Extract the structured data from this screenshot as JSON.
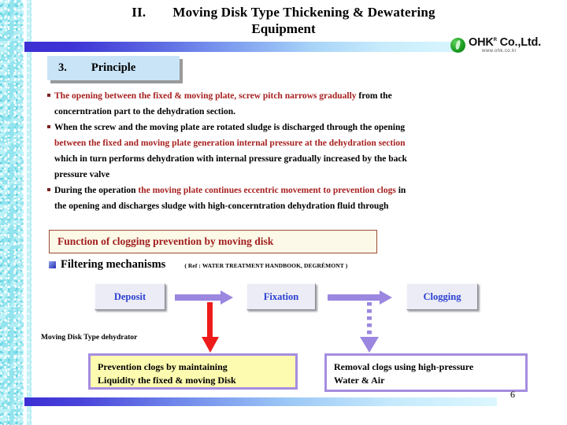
{
  "slide": {
    "page_number": "6",
    "title": {
      "number": "II.",
      "line1": "Moving Disk Type Thickening & Dewatering",
      "line2": "Equipment"
    },
    "logo": {
      "name": "OHK",
      "suffix": "Co.,Ltd.",
      "superscript": "R",
      "url": "www.ohk.co.kr"
    },
    "section": {
      "number": "3.",
      "label": "Principle"
    },
    "bullets": [
      {
        "red_text": "The opening between the fixed & moving plate, screw pitch narrows gradually",
        "black_text": " from the",
        "continuation": "concerntration part to the dehydration section."
      },
      {
        "black_text": "When the screw and the moving plate are rotated sludge is discharged through the opening",
        "red_continuation": "between the fixed and moving plate generation internal pressure at the dehydration section",
        "continuation2": "which in turn performs dehydration with internal pressure gradually increased by the back",
        "continuation3": "pressure valve"
      },
      {
        "black_text": "During the operation ",
        "red_text": "the moving plate continues eccentric movement to prevention clogs",
        "black_text2": " in",
        "continuation": "the opening and discharges sludge with high-concerntration dehydration fluid through"
      }
    ],
    "function_banner": "Function of clogging prevention by moving disk",
    "filtering": {
      "title": "Filtering mechanisms",
      "reference": "( Ref : WATER TREATMENT HANDBOOK,  DEGRÉMONT )"
    },
    "flow_boxes": [
      {
        "label": "Deposit"
      },
      {
        "label": "Fixation"
      },
      {
        "label": "Clogging"
      }
    ],
    "dehydrator_label": "Moving Disk Type dehydrator",
    "result_boxes": [
      {
        "line1": "Prevention clogs by maintaining",
        "line2": "Liquidity the fixed & moving Disk"
      },
      {
        "line1": "Removal clogs using high-pressure",
        "line2": "Water & Air"
      }
    ],
    "colors": {
      "red_accent": "#a82020",
      "blue_box_text": "#2a3fd0",
      "purple_arrow": "#9b86e0",
      "red_arrow": "#ee1b1b",
      "yellow_box": "#fdfbb0",
      "chip_blue": "#c9e4f7"
    }
  }
}
